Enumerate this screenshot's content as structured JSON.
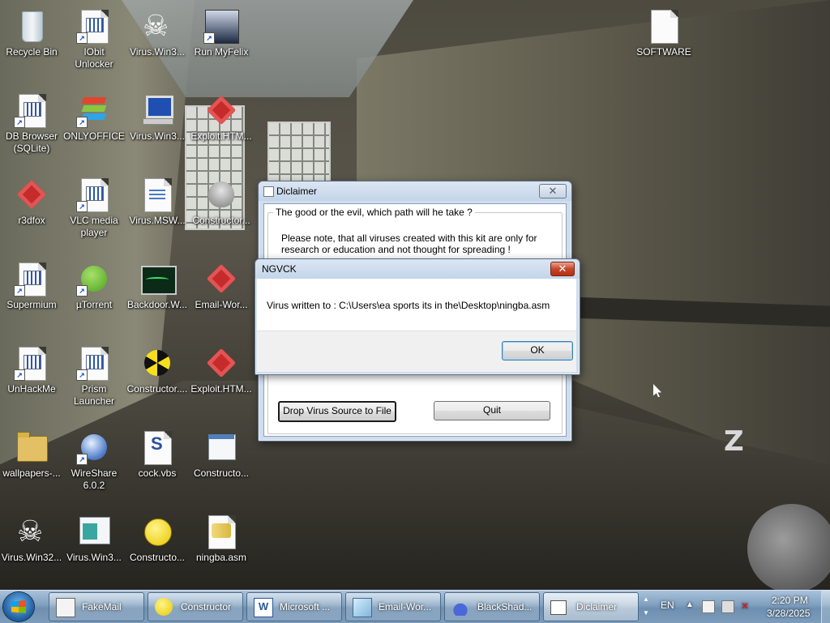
{
  "desktop": {
    "icons": [
      {
        "label": "Recycle Bin"
      },
      {
        "label": "IObit Unlocker"
      },
      {
        "label": "Virus.Win3..."
      },
      {
        "label": "Run MyFelix"
      },
      {
        "label": "SOFTWARE"
      },
      {
        "label": "DB Browser (SQLite)"
      },
      {
        "label": "ONLYOFFICE"
      },
      {
        "label": "Virus.Win3..."
      },
      {
        "label": "Exploit.HTM..."
      },
      {
        "label": "r3dfox"
      },
      {
        "label": "VLC media player"
      },
      {
        "label": "Virus.MSW..."
      },
      {
        "label": "Constructor..."
      },
      {
        "label": "Supermium"
      },
      {
        "label": "µTorrent"
      },
      {
        "label": "Backdoor.W..."
      },
      {
        "label": "Email-Wor..."
      },
      {
        "label": "UnHackMe"
      },
      {
        "label": "Prism Launcher"
      },
      {
        "label": "Constructor...."
      },
      {
        "label": "Exploit.HTM..."
      },
      {
        "label": "wallpapers-..."
      },
      {
        "label": "WireShare 6.0.2"
      },
      {
        "label": "cock.vbs"
      },
      {
        "label": "Constructo..."
      },
      {
        "label": "Virus.Win32..."
      },
      {
        "label": "Virus.Win3..."
      },
      {
        "label": "Constructo..."
      },
      {
        "label": "ningba.asm"
      }
    ],
    "z_letter": "Z"
  },
  "disclaimer_dialog": {
    "title": "Diclaimer",
    "close_glyph": "✕",
    "group_legend": "The good or the  evil, which path will he take ?",
    "notice": "Please note, that all viruses created with this kit are only for research or education and not thought for spreading !",
    "drop_button": "Drop Virus Source to File",
    "quit_button": "Quit"
  },
  "ngvck_dialog": {
    "title": "NGVCK",
    "close_glyph": "✕",
    "message": "Virus written to : C:\\Users\\ea sports its in the\\Desktop\\ningba.asm",
    "ok_button": "OK"
  },
  "taskbar": {
    "buttons": [
      {
        "label": "FakeMail"
      },
      {
        "label": "Constructor"
      },
      {
        "label": "Microsoft ..."
      },
      {
        "label": "Email-Wor..."
      },
      {
        "label": "BlackShad..."
      },
      {
        "label": "Diclaimer",
        "active": true
      }
    ],
    "language": "EN",
    "time": "2:20 PM",
    "date": "3/28/2025"
  }
}
